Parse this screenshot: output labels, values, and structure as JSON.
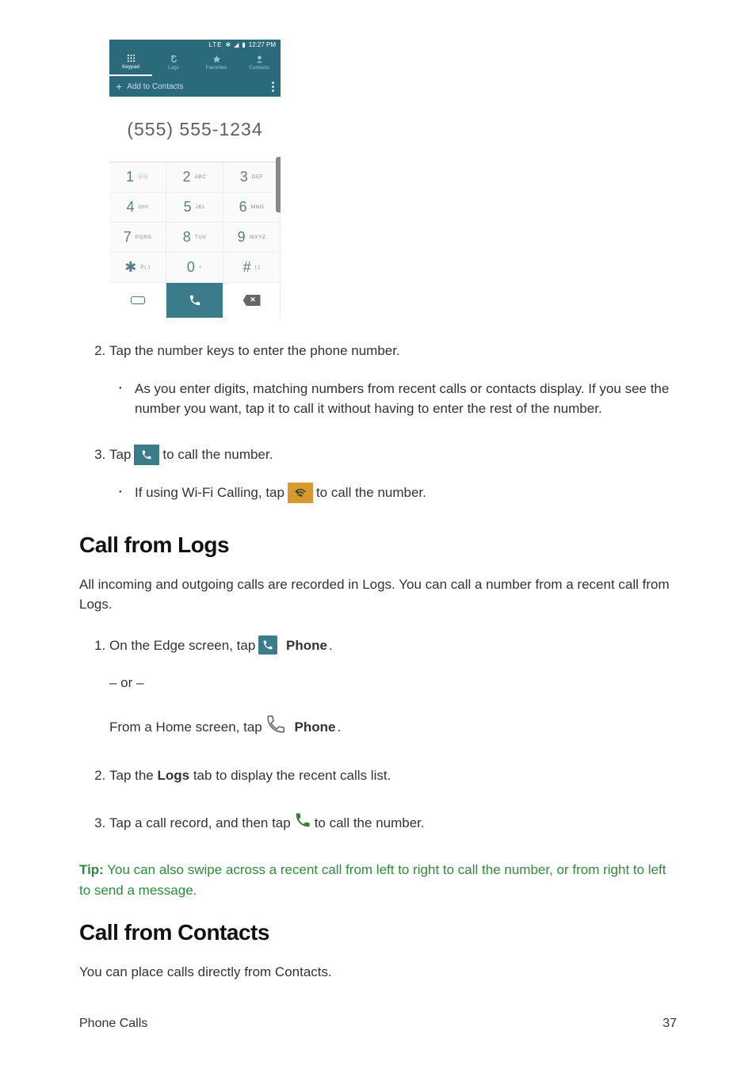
{
  "phone": {
    "status_time": "12:27 PM",
    "status_net": "LTE",
    "tabs": [
      {
        "label": "Keypad"
      },
      {
        "label": "Logs"
      },
      {
        "label": "Favorites"
      },
      {
        "label": "Contacts"
      }
    ],
    "add_contacts": "Add to Contacts",
    "number_entered": "(555) 555-1234",
    "keys": [
      {
        "d": "1",
        "l": ""
      },
      {
        "d": "2",
        "l": "ABC"
      },
      {
        "d": "3",
        "l": "DEF"
      },
      {
        "d": "4",
        "l": "GHI"
      },
      {
        "d": "5",
        "l": "JKL"
      },
      {
        "d": "6",
        "l": "MNO"
      },
      {
        "d": "7",
        "l": "PQRS"
      },
      {
        "d": "8",
        "l": "TUV"
      },
      {
        "d": "9",
        "l": "WXYZ"
      },
      {
        "d": "✱",
        "l": "P(,)"
      },
      {
        "d": "0",
        "l": "+"
      },
      {
        "d": "#",
        "l": "|;|"
      }
    ]
  },
  "steps_a": {
    "s2": "Tap the number keys to enter the phone number.",
    "s2_bullet": "As you enter digits, matching numbers from recent calls or contacts display. If you see the number you want, tap it to call it without having to enter the rest of the number.",
    "s3_pre": "Tap ",
    "s3_post": " to call the number.",
    "s3_bullet_pre": "If using Wi-Fi Calling, tap ",
    "s3_bullet_post": " to call the number."
  },
  "section_logs": {
    "heading": "Call from Logs",
    "intro": "All incoming and outgoing calls are recorded in Logs. You can call a number from a recent call from Logs.",
    "s1_pre": "On the Edge screen, tap ",
    "s1_phone": "Phone",
    "s1_dot": ".",
    "or": "– or –",
    "s1b_pre": "From a Home screen, tap ",
    "s1b_phone": "Phone",
    "s2_pre": "Tap the ",
    "s2_logs": "Logs",
    "s2_post": " tab to display the recent calls list.",
    "s3_pre": "Tap a call record, and then tap ",
    "s3_post": " to call the number.",
    "tip_label": "Tip:",
    "tip_text": " You can also swipe across a recent call from left to right to call the number, or from right to left to send a message."
  },
  "section_contacts": {
    "heading": "Call from Contacts",
    "intro": "You can place calls directly from Contacts."
  },
  "footer": {
    "section": "Phone Calls",
    "page": "37"
  },
  "icons": {
    "vm_sub": "ⓞⓞ"
  }
}
